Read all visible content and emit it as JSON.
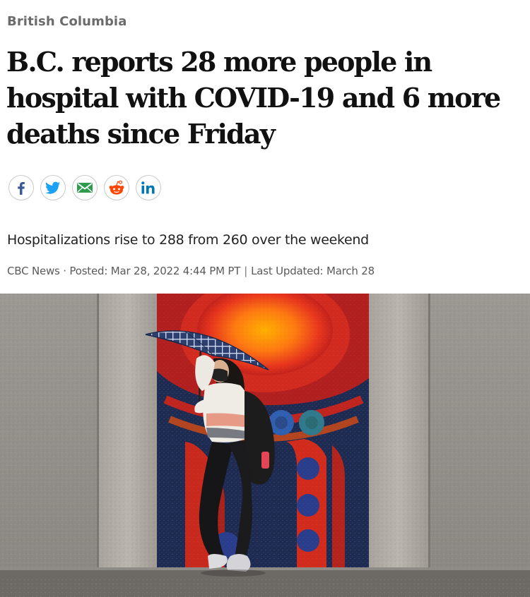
{
  "section": {
    "label": "British Columbia"
  },
  "headline": "B.C. reports 28 more people in hospital with COVID-19 and 6 more deaths since Friday",
  "share": {
    "buttons": [
      {
        "name": "facebook",
        "icon": "facebook-icon",
        "color": "#3b5998"
      },
      {
        "name": "twitter",
        "icon": "twitter-icon",
        "color": "#1da1f2"
      },
      {
        "name": "email",
        "icon": "email-icon",
        "color": "#2e9b4f"
      },
      {
        "name": "reddit",
        "icon": "reddit-icon",
        "color": "#ff4500"
      },
      {
        "name": "linkedin",
        "icon": "linkedin-icon",
        "color": "#0077b5"
      }
    ]
  },
  "deck": "Hospitalizations rise to 288 from 260 over the weekend",
  "byline": {
    "source": "CBC News",
    "posted": "Posted: Mar 28, 2022 4:44 PM PT",
    "separator": "|",
    "updated": "Last Updated: March 28"
  },
  "hero_image": {
    "subject": "person with umbrella walking past mural"
  }
}
